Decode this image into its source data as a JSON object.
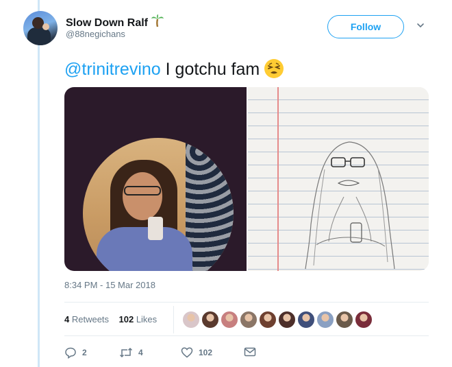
{
  "user": {
    "name": "Slow Down Ralf",
    "name_emoji": "palm-tree",
    "handle": "@88negichans"
  },
  "follow": {
    "label": "Follow"
  },
  "tweet": {
    "mention": "@trinitrevino",
    "text": " I gotchu fam",
    "emoji": "persevering-face"
  },
  "media": [
    {
      "kind": "photo",
      "description_icon": "selfie-photo"
    },
    {
      "kind": "photo",
      "description_icon": "pencil-drawing"
    }
  ],
  "timestamp": "8:34 PM - 15 Mar 2018",
  "stats": {
    "retweets_count": "4",
    "retweets_label": " Retweets",
    "likes_count": "102",
    "likes_label": " Likes"
  },
  "liker_colors": [
    "#d9c6c9",
    "#5a3a2e",
    "#c77f7f",
    "#8b7667",
    "#6e4030",
    "#4d2f2a",
    "#3f4f7a",
    "#8aa0c2",
    "#6a5a4a",
    "#7a2d3a"
  ],
  "actions": {
    "reply_count": "2",
    "retweet_count": "4",
    "like_count": "102"
  },
  "colors": {
    "accent": "#1da1f2",
    "muted": "#657786",
    "text": "#14171a"
  }
}
